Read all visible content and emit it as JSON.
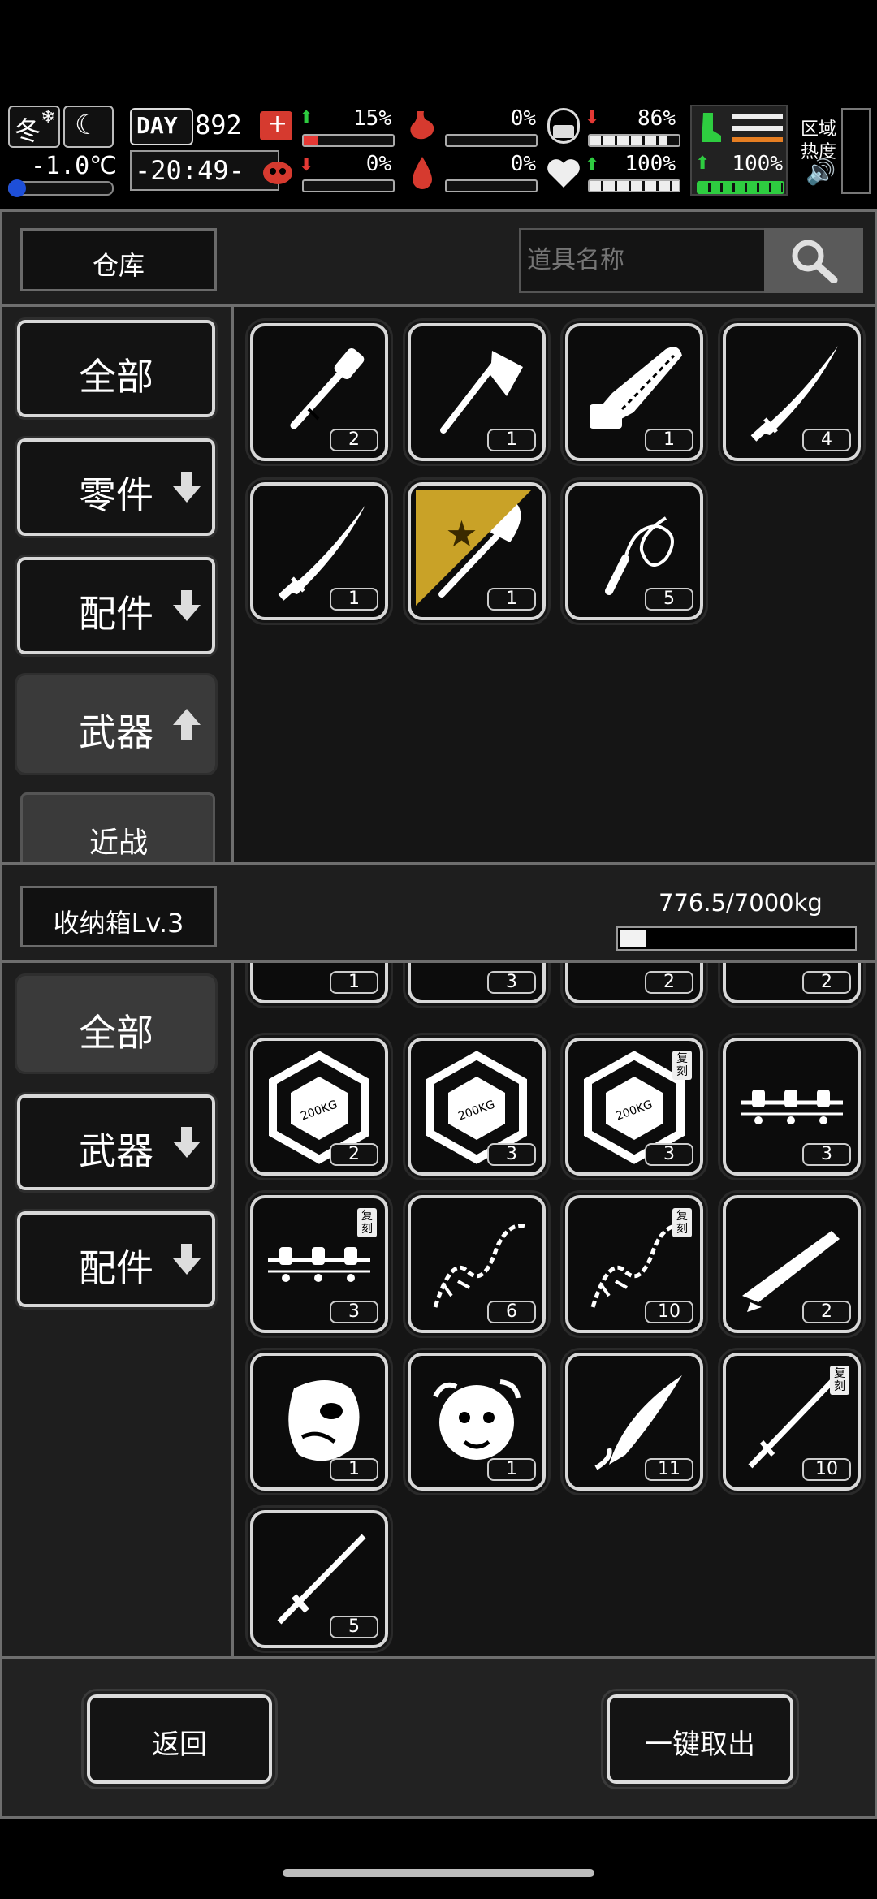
{
  "status": {
    "season": "冬",
    "temperature": "-1.0℃",
    "day_label": "DAY",
    "day_number": "892",
    "time": "-20:49-",
    "health_pct": "15%",
    "stomach_pct": "0%",
    "hygiene_pct": "86%",
    "virus_pct": "0%",
    "water_pct": "0%",
    "heart_pct": "100%",
    "stamina_pct": "100%",
    "zone_label_1": "区域",
    "zone_label_2": "热度",
    "health_fill": 0.15,
    "hygiene_fill": 0.86,
    "heart_fill": 1.0,
    "stamina_fill": 1.0
  },
  "warehouse": {
    "title": "仓库",
    "search_placeholder": "道具名称",
    "categories": [
      {
        "label": "全部",
        "arrow": "none"
      },
      {
        "label": "零件",
        "arrow": "down"
      },
      {
        "label": "配件",
        "arrow": "down"
      },
      {
        "label": "武器",
        "arrow": "up"
      },
      {
        "label": "近战",
        "arrow": "none"
      }
    ],
    "items": [
      {
        "icon": "club-icon",
        "count": "2"
      },
      {
        "icon": "axe-icon",
        "count": "1"
      },
      {
        "icon": "chainsaw-icon",
        "count": "1"
      },
      {
        "icon": "katana-icon",
        "count": "4"
      },
      {
        "icon": "katana-icon",
        "count": "1"
      },
      {
        "icon": "shovel-icon",
        "count": "1"
      },
      {
        "icon": "whip-icon",
        "count": "5"
      }
    ]
  },
  "storage": {
    "title": "收纳箱Lv.3",
    "capacity": "776.5/7000kg",
    "capacity_fill": 0.11,
    "categories": [
      {
        "label": "全部",
        "arrow": "none"
      },
      {
        "label": "武器",
        "arrow": "down"
      },
      {
        "label": "配件",
        "arrow": "down"
      }
    ],
    "partial_items": [
      {
        "count": "1"
      },
      {
        "count": "3"
      },
      {
        "count": "2"
      },
      {
        "count": "2"
      }
    ],
    "items": [
      {
        "icon": "weight-plate-icon",
        "count": "2",
        "copy": ""
      },
      {
        "icon": "weight-plate-icon",
        "count": "3",
        "copy": ""
      },
      {
        "icon": "weight-plate-icon",
        "count": "3",
        "copy": "复刻"
      },
      {
        "icon": "ammo-belt-icon",
        "count": "3",
        "copy": ""
      },
      {
        "icon": "ammo-belt-icon",
        "count": "3",
        "copy": "复刻"
      },
      {
        "icon": "chain-whip-icon",
        "count": "6",
        "copy": ""
      },
      {
        "icon": "chain-whip-icon",
        "count": "10",
        "copy": "复刻"
      },
      {
        "icon": "rifle-icon",
        "count": "2",
        "copy": ""
      },
      {
        "icon": "mask-icon",
        "count": "1",
        "copy": ""
      },
      {
        "icon": "medusa-mask-icon",
        "count": "1",
        "copy": ""
      },
      {
        "icon": "curved-blade-icon",
        "count": "11",
        "copy": ""
      },
      {
        "icon": "long-sword-icon",
        "count": "10",
        "copy": "复刻"
      },
      {
        "icon": "sword-icon",
        "count": "5",
        "copy": ""
      }
    ]
  },
  "footer": {
    "back_label": "返回",
    "take_all_label": "一键取出"
  },
  "colors": {
    "panel_bg": "#1e1e1e",
    "green": "#2ecc40",
    "red": "#e53935",
    "orange": "#e67e22"
  }
}
